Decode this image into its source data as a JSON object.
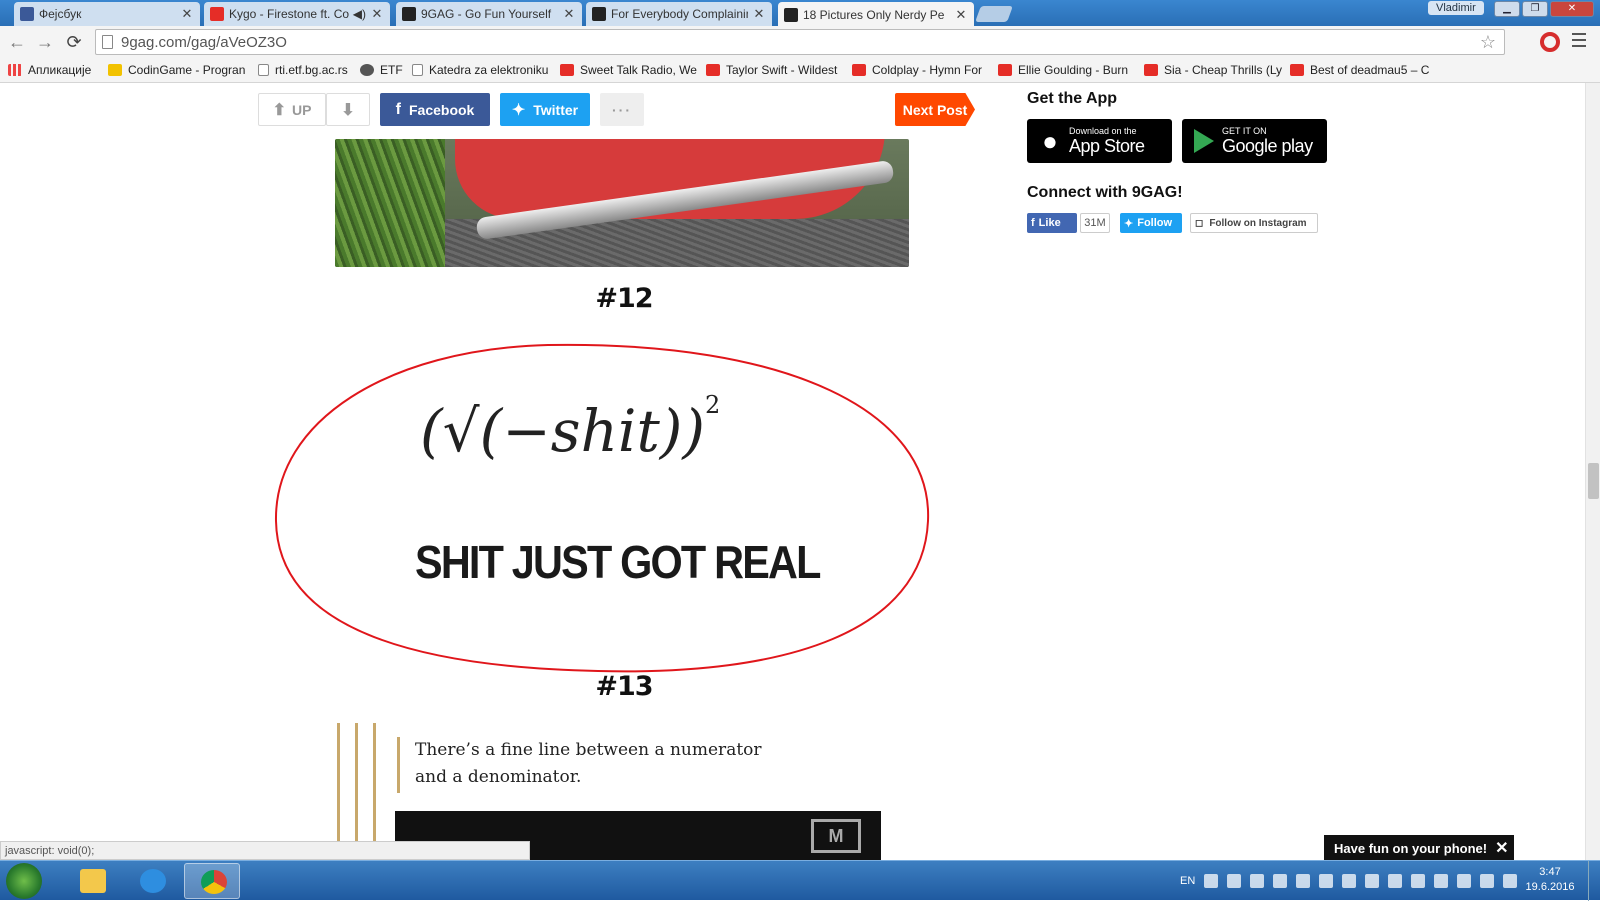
{
  "browser": {
    "tabs": [
      {
        "title": "Фејсбук",
        "icon": "facebook-icon",
        "active": false
      },
      {
        "title": "Kygo - Firestone ft. Co",
        "icon": "youtube-icon",
        "active": false,
        "audio": true
      },
      {
        "title": "9GAG - Go Fun Yourself",
        "icon": "9gag-icon",
        "active": false
      },
      {
        "title": "For Everybody Complainin",
        "icon": "9gag-icon",
        "active": false
      },
      {
        "title": "18 Pictures Only Nerdy Pe",
        "icon": "9gag-icon",
        "active": true
      }
    ],
    "window_user": "Vladimir",
    "url": "9gag.com/gag/aVeOZ3O",
    "bookmarks": [
      {
        "label": "Апликације",
        "icon": "apps-icon"
      },
      {
        "label": "CodinGame - Progran",
        "icon": "codingame-icon"
      },
      {
        "label": "rti.etf.bg.ac.rs",
        "icon": "page-icon"
      },
      {
        "label": "ETF",
        "icon": "etf-icon"
      },
      {
        "label": "Katedra za elektroniku",
        "icon": "page-icon"
      },
      {
        "label": "Sweet Talk Radio, We",
        "icon": "youtube-icon"
      },
      {
        "label": "Taylor Swift - Wildest",
        "icon": "youtube-icon"
      },
      {
        "label": "Coldplay - Hymn For",
        "icon": "youtube-icon"
      },
      {
        "label": "Ellie Goulding - Burn",
        "icon": "youtube-icon"
      },
      {
        "label": "Sia - Cheap Thrills (Ly",
        "icon": "youtube-icon"
      },
      {
        "label": "Best of deadmau5 – C",
        "icon": "youtube-icon"
      }
    ],
    "status_text": "javascript: void(0);"
  },
  "post_bar": {
    "up_label": "UP",
    "facebook_label": "Facebook",
    "twitter_label": "Twitter",
    "more_label": "···",
    "next_label": "Next Post"
  },
  "content": {
    "caption_12": "#12",
    "meme_math_base": "(√(−shit))",
    "meme_math_exp": "2",
    "meme_caption": "SHIT JUST GOT REAL",
    "caption_13": "#13",
    "quote_line1": "There’s a fine line between a numerator",
    "quote_line2": "and a denominator.",
    "video_logo": "M"
  },
  "sidebar": {
    "get_app_title": "Get the App",
    "appstore_small": "Download on the",
    "appstore_big": "App Store",
    "gplay_small": "GET IT ON",
    "gplay_big": "Google play",
    "connect_title": "Connect with 9GAG!",
    "fb_like": "Like",
    "fb_count": "31M",
    "tw_follow": "Follow",
    "ig_follow": "Follow on Instagram"
  },
  "toast": {
    "text": "Have fun on your phone!",
    "close": "✕"
  },
  "taskbar": {
    "lang": "EN",
    "time": "3:47",
    "date": "19.6.2016"
  },
  "colors": {
    "facebook": "#3b5998",
    "twitter": "#1da1f2",
    "next_post": "#ff4800",
    "circle": "#e0161b"
  }
}
